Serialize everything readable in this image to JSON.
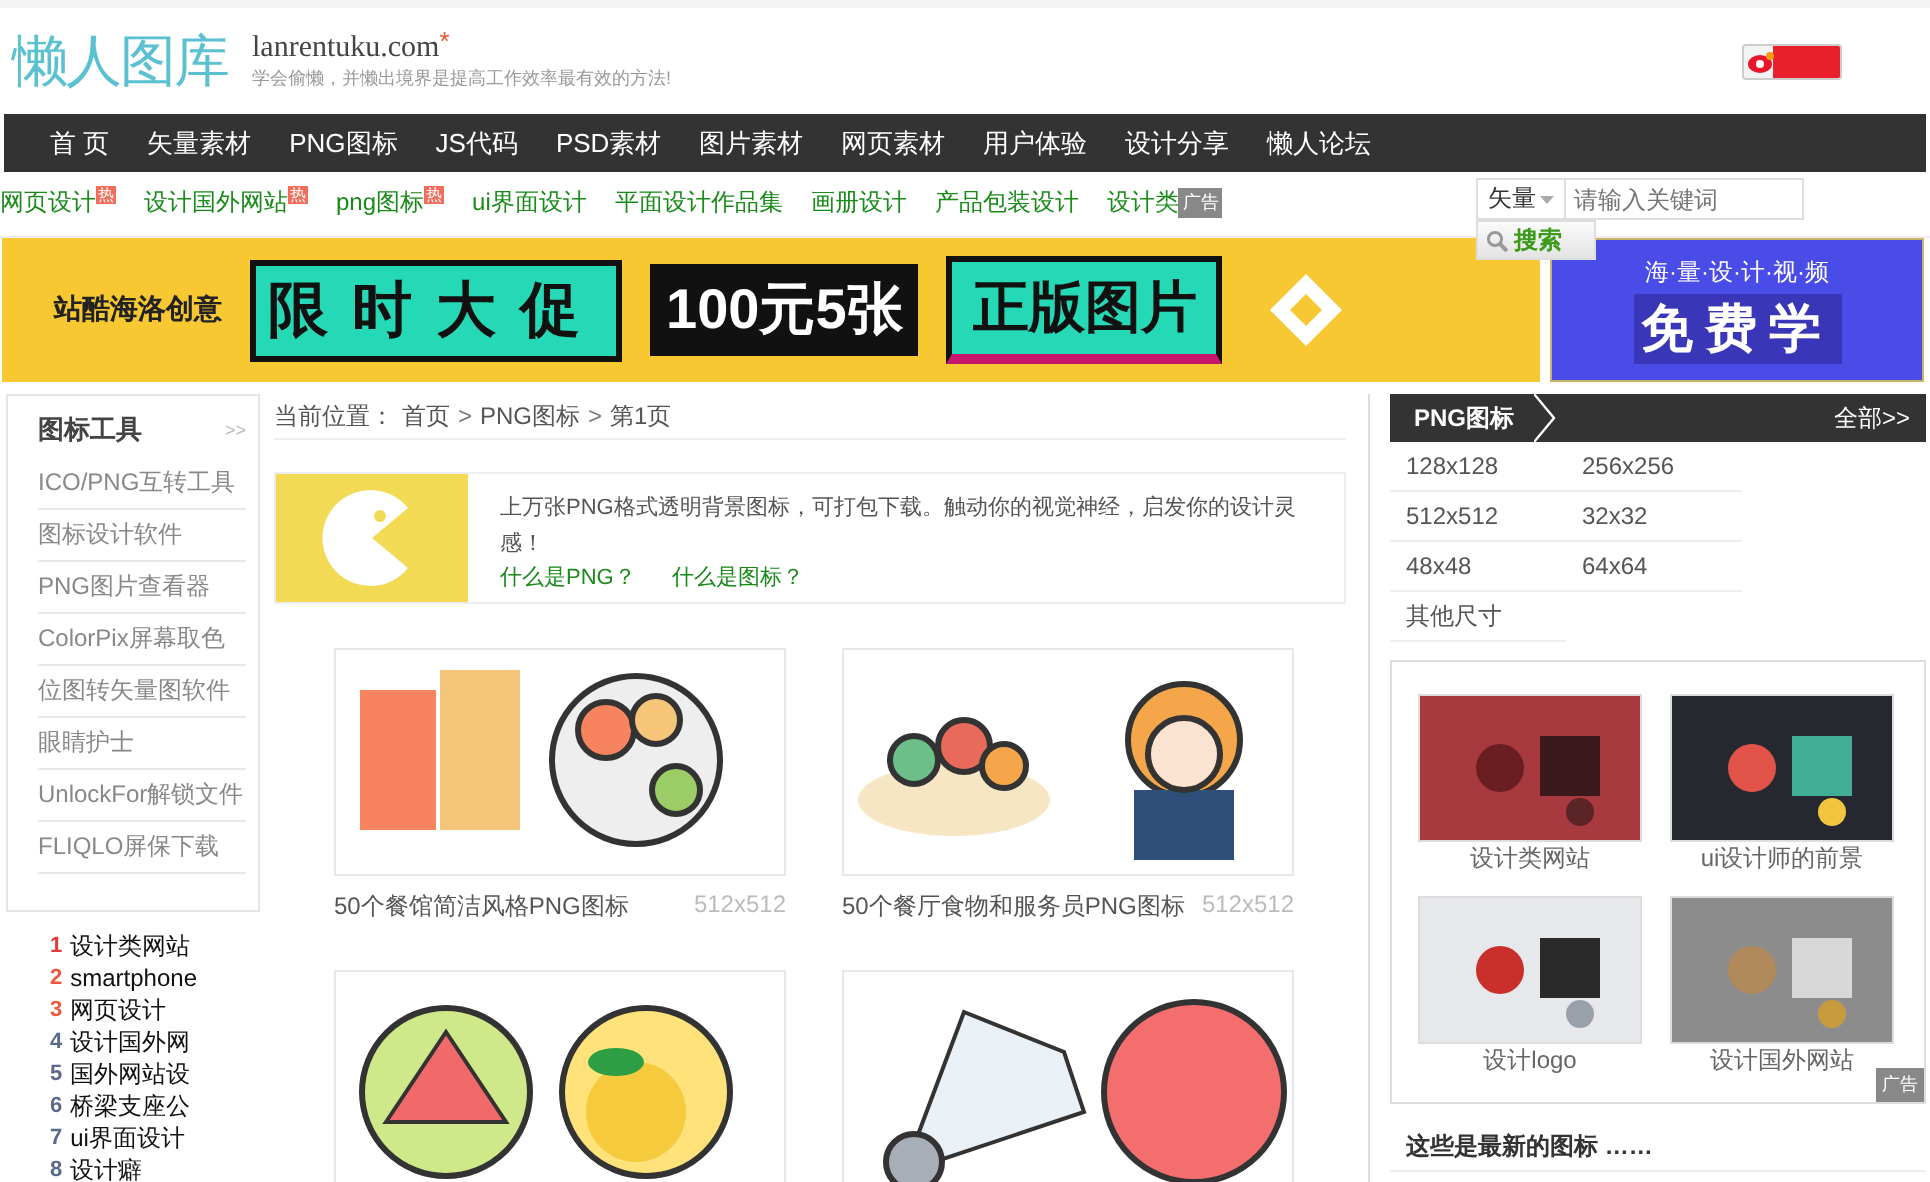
{
  "header": {
    "logo": "懒人图库",
    "domain": "lanrentuku.com",
    "star": "*",
    "slogan": "学会偷懒，并懒出境界是提高工作效率最有效的方法!"
  },
  "nav": [
    "首 页",
    "矢量素材",
    "PNG图标",
    "JS代码",
    "PSD素材",
    "图片素材",
    "网页素材",
    "用户体验",
    "设计分享",
    "懒人论坛"
  ],
  "subnav": [
    {
      "label": "网页设计",
      "badge": "热"
    },
    {
      "label": "设计国外网站",
      "badge": "热"
    },
    {
      "label": "png图标",
      "badge": "热"
    },
    {
      "label": "ui界面设计"
    },
    {
      "label": "平面设计作品集"
    },
    {
      "label": "画册设计"
    },
    {
      "label": "产品包装设计"
    },
    {
      "label": "设计类"
    }
  ],
  "subnav_ad": "广告",
  "search": {
    "category": "矢量",
    "placeholder": "请输入关键词",
    "button": "搜索"
  },
  "banners": {
    "left": {
      "brand": "站酷海洛创意",
      "headline": "限时大促",
      "offer": "100元5张",
      "tag": "正版图片"
    },
    "right": {
      "tagline": "海·量·设·计·视·频",
      "headline": "免费学"
    }
  },
  "tools": {
    "title": "图标工具",
    "more": ">>",
    "items": [
      "ICO/PNG互转工具",
      "图标设计软件",
      "PNG图片查看器",
      "ColorPix屏幕取色",
      "位图转矢量图软件",
      "眼睛护士",
      "UnlockFor解锁文件",
      "FLIQLO屏保下载"
    ]
  },
  "ranking": [
    {
      "num": "1",
      "label": "设计类网站",
      "color": "#e4393c"
    },
    {
      "num": "2",
      "label": "smartphone",
      "color": "#f0573c"
    },
    {
      "num": "3",
      "label": "网页设计",
      "color": "#f0573c"
    },
    {
      "num": "4",
      "label": "设计国外网",
      "color": "#5a6a8a"
    },
    {
      "num": "5",
      "label": "国外网站设",
      "color": "#5a6a8a"
    },
    {
      "num": "6",
      "label": "桥梁支座公",
      "color": "#5a6a8a"
    },
    {
      "num": "7",
      "label": "ui界面设计",
      "color": "#5a6a8a"
    },
    {
      "num": "8",
      "label": "设计癖",
      "color": "#5a6a8a"
    }
  ],
  "breadcrumb": {
    "label": "当前位置：",
    "separator": ">",
    "items": [
      "首页",
      "PNG图标",
      "第1页"
    ]
  },
  "intro": {
    "text": "上万张PNG格式透明背景图标，可打包下载。触动你的视觉神经，启发你的设计灵感！",
    "links": [
      "什么是PNG？",
      "什么是图标？"
    ]
  },
  "cards": [
    {
      "kind": "titled",
      "title": "50个餐馆简洁风格PNG图标",
      "size": "512x512"
    },
    {
      "kind": "titled",
      "title": "50个餐厅食物和服务员PNG图标",
      "size": "512x512"
    },
    {
      "kind": "picture"
    },
    {
      "kind": "picture"
    }
  ],
  "right": {
    "title": "PNG图标",
    "more": "全部>>",
    "sizes": [
      "128x128",
      "256x256",
      "512x512",
      "32x32",
      "48x48",
      "64x64",
      "其他尺寸"
    ],
    "ads": [
      {
        "caption": "设计类网站"
      },
      {
        "caption": "ui设计师的前景"
      },
      {
        "caption": "设计logo"
      },
      {
        "caption": "设计国外网站"
      }
    ],
    "ad_badge": "广告",
    "latest": "这些是最新的图标 ……"
  }
}
